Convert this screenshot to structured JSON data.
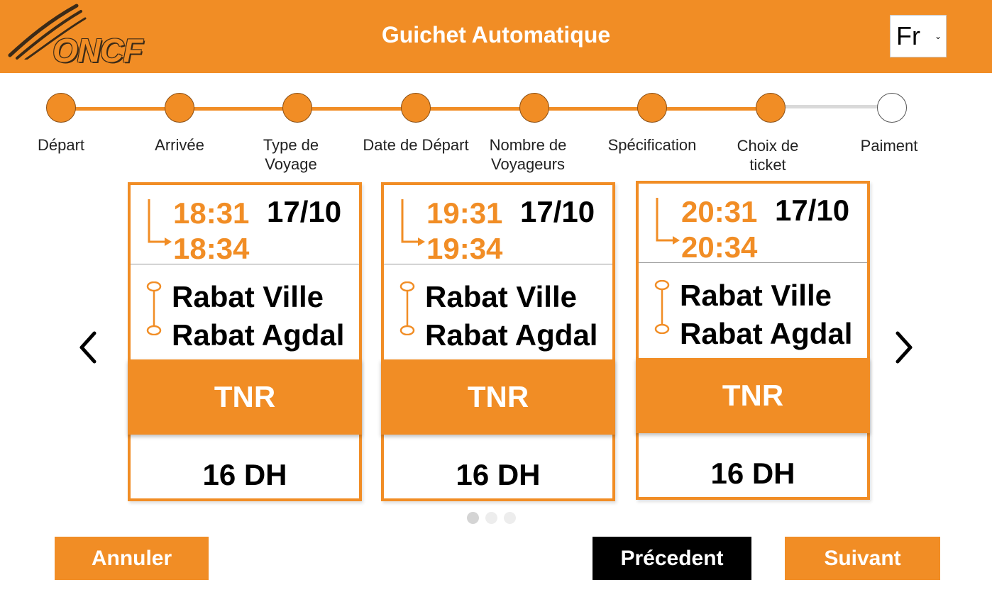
{
  "header": {
    "logo_text": "ONCF",
    "title": "Guichet Automatique",
    "language": {
      "selected": "Fr",
      "icon": "chevron-down-icon"
    }
  },
  "colors": {
    "accent": "#F18D25",
    "pending_step": "#FFFFFF",
    "track_done": "#F18D25",
    "track_pending": "#D9D9D9",
    "back_button": "#000000"
  },
  "steps": [
    {
      "label": "Départ",
      "status": "done"
    },
    {
      "label": "Arrivée",
      "status": "done"
    },
    {
      "label": "Type de Voyage",
      "status": "done"
    },
    {
      "label": "Date de Départ",
      "status": "done"
    },
    {
      "label": "Nombre de Voyageurs",
      "status": "done"
    },
    {
      "label": "Spécification",
      "status": "done"
    },
    {
      "label": "Choix de ticket",
      "status": "current"
    },
    {
      "label": "Paiment",
      "status": "pending"
    }
  ],
  "carousel": {
    "prev_icon": "chevron-left-icon",
    "next_icon": "chevron-right-icon",
    "page_count": 3,
    "active_page": 1,
    "tickets": [
      {
        "departure_time": "18:31",
        "arrival_time": "18:34",
        "date": "17/10",
        "from": "Rabat Ville",
        "to": "Rabat Agdal",
        "fare_type": "TNR",
        "price": "16 DH"
      },
      {
        "departure_time": "19:31",
        "arrival_time": "19:34",
        "date": "17/10",
        "from": "Rabat Ville",
        "to": "Rabat Agdal",
        "fare_type": "TNR",
        "price": "16 DH"
      },
      {
        "departure_time": "20:31",
        "arrival_time": "20:34",
        "date": "17/10",
        "from": "Rabat Ville",
        "to": "Rabat Agdal",
        "fare_type": "TNR",
        "price": "16 DH"
      }
    ]
  },
  "footer": {
    "cancel_label": "Annuler",
    "previous_label": "Précedent",
    "next_label": "Suivant"
  }
}
